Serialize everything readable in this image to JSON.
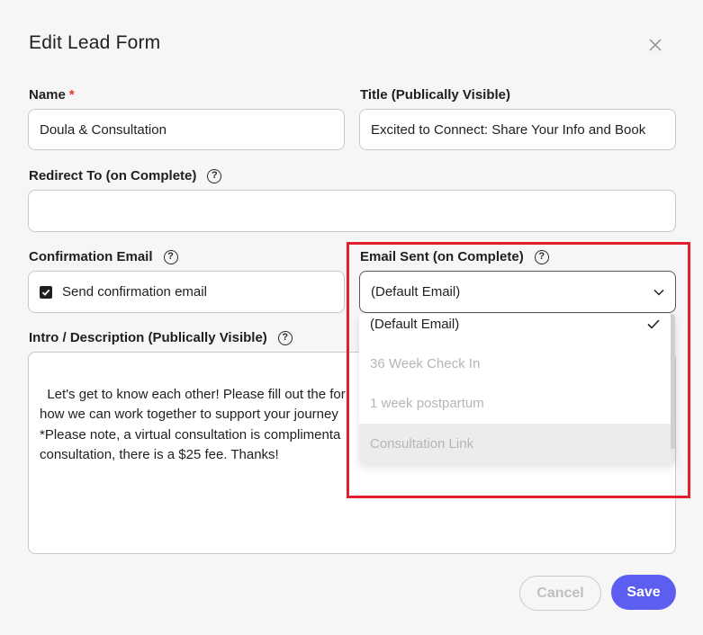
{
  "modal": {
    "title": "Edit Lead Form",
    "close_icon": "close-icon"
  },
  "fields": {
    "name": {
      "label": "Name",
      "required_mark": "*",
      "value": "Doula & Consultation"
    },
    "title": {
      "label": "Title (Publically Visible)",
      "value": "Excited to Connect: Share Your Info and Book"
    },
    "redirect": {
      "label": "Redirect To (on Complete)",
      "value": "",
      "help_icon": "question-circle-icon"
    },
    "confirmation": {
      "label": "Confirmation Email",
      "checkbox_label": "Send confirmation email",
      "checked": true,
      "help_icon": "question-circle-icon"
    },
    "email_sent": {
      "label": "Email Sent (on Complete)",
      "value": "(Default Email)",
      "help_icon": "question-circle-icon"
    },
    "intro": {
      "label": "Intro / Description (Publically Visible)",
      "value": "Let's get to know each other! Please fill out the for\nhow we can work together to support your journey\n*Please note, a virtual consultation is complimenta\nconsultation, there is a $25 fee. Thanks!",
      "help_icon": "question-circle-icon"
    }
  },
  "dropdown": {
    "options": [
      {
        "label": "(Default Email)",
        "selected": true
      },
      {
        "label": "36 Week Check In",
        "selected": false
      },
      {
        "label": "1 week postpartum",
        "selected": false
      },
      {
        "label": "Consultation Link",
        "selected": false
      }
    ],
    "check_icon": "checkmark-icon"
  },
  "buttons": {
    "cancel": "Cancel",
    "save": "Save"
  },
  "colors": {
    "accent": "#5b5ef0",
    "highlight": "#e0202a",
    "required": "#e0362c"
  }
}
